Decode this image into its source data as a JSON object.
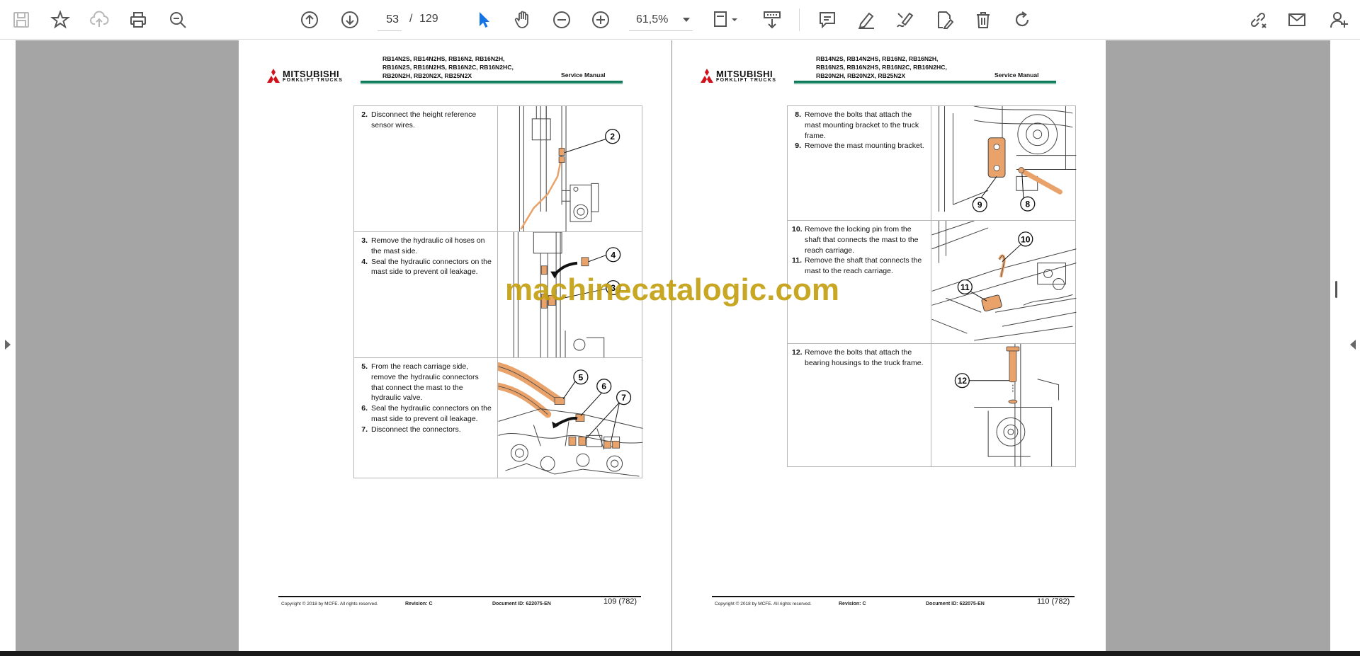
{
  "toolbar": {
    "page_current": "53",
    "page_separator": "/",
    "page_total": "129",
    "zoom": "61,5%"
  },
  "pages": [
    {
      "header": {
        "brand": "MITSUBISHI",
        "brand_sub": "FORKLIFT TRUCKS",
        "models_line1": "RB14N2S, RB14N2HS, RB16N2, RB16N2H,",
        "models_line2": "RB16N2S, RB16N2HS, RB16N2C, RB16N2HC,",
        "models_line3": "RB20N2H, RB20N2X, RB25N2X",
        "manual": "Service Manual"
      },
      "rows": [
        {
          "lines": [
            {
              "num": "2.",
              "text": "Disconnect the height reference sensor wires."
            }
          ]
        },
        {
          "lines": [
            {
              "num": "3.",
              "text": "Remove the hydraulic oil hoses on the mast side."
            },
            {
              "num": "4.",
              "text": "Seal the hydraulic connectors on the mast side to prevent oil leakage."
            }
          ]
        },
        {
          "lines": [
            {
              "num": "5.",
              "text": "From the reach carriage side, remove the hydraulic connectors that connect the mast to the hydraulic valve."
            },
            {
              "num": "6.",
              "text": "Seal the hydraulic connectors on the mast side to prevent oil leakage."
            },
            {
              "num": "7.",
              "text": "Disconnect the connectors."
            }
          ]
        }
      ],
      "callouts": {
        "c2": "2",
        "c3": "3",
        "c4": "4",
        "c5": "5",
        "c6": "6",
        "c7": "7"
      },
      "footer": {
        "copyright": "Copyright © 2018 by MCFE. All rights reserved.",
        "revision": "Revision: C",
        "document_id": "Document ID: 622075-EN",
        "page_number": "109 (782)"
      }
    },
    {
      "header": {
        "brand": "MITSUBISHI",
        "brand_sub": "FORKLIFT TRUCKS",
        "models_line1": "RB14N2S, RB14N2HS, RB16N2, RB16N2H,",
        "models_line2": "RB16N2S, RB16N2HS, RB16N2C, RB16N2HC,",
        "models_line3": "RB20N2H, RB20N2X, RB25N2X",
        "manual": "Service Manual"
      },
      "rows": [
        {
          "lines": [
            {
              "num": "8.",
              "text": "Remove the bolts that attach the mast mounting bracket to the truck frame."
            },
            {
              "num": "9.",
              "text": "Remove the mast mounting bracket."
            }
          ]
        },
        {
          "lines": [
            {
              "num": "10.",
              "text": "Remove the locking pin from the shaft that connects the mast to the reach carriage."
            },
            {
              "num": "11.",
              "text": "Remove the shaft that connects the mast to the reach carriage."
            }
          ]
        },
        {
          "lines": [
            {
              "num": "12.",
              "text": "Remove the bolts that attach the bearing housings to the truck frame."
            }
          ]
        }
      ],
      "callouts": {
        "c8": "8",
        "c9": "9",
        "c10": "10",
        "c11": "11",
        "c12": "12"
      },
      "footer": {
        "copyright": "Copyright © 2018 by MCFE. All rights reserved.",
        "revision": "Revision: C",
        "document_id": "Document ID: 622075-EN",
        "page_number": "110 (782)"
      }
    }
  ],
  "watermark": "machinecatalogic.com",
  "colors": {
    "accent": "#1473e6",
    "header_rule": "#0b7a59",
    "highlight_part": "#e8a26a",
    "watermark": "#c4a012",
    "viewer_bg": "#a5a5a5"
  }
}
